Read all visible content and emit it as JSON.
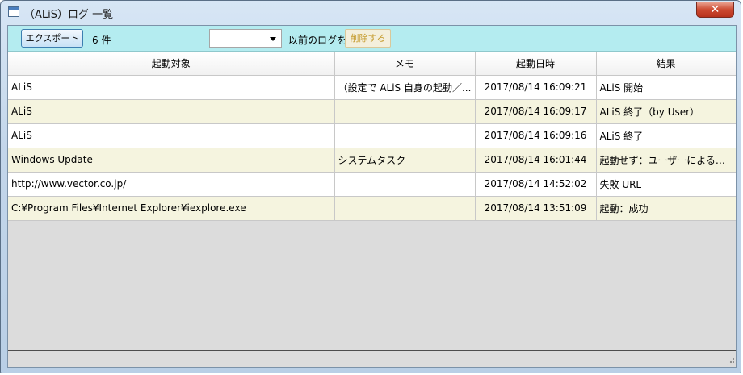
{
  "window": {
    "title": "（ALiS）ログ 一覧",
    "close_label": "✕"
  },
  "toolbar": {
    "export_label": "エクスポート",
    "count_text": "6 件",
    "date_select_value": "",
    "before_label": "以前のログを",
    "delete_label": "削除する"
  },
  "grid": {
    "columns": [
      "起動対象",
      "メモ",
      "起動日時",
      "結果"
    ],
    "rows": [
      {
        "target": "ALiS",
        "memo": "（設定で ALiS 自身の起動／...",
        "datetime": "2017/08/14 16:09:21",
        "result": "ALiS 開始"
      },
      {
        "target": "ALiS",
        "memo": "",
        "datetime": "2017/08/14 16:09:17",
        "result": "ALiS 終了（by User）"
      },
      {
        "target": "ALiS",
        "memo": "",
        "datetime": "2017/08/14 16:09:16",
        "result": "ALiS 終了"
      },
      {
        "target": "Windows Update",
        "memo": "システムタスク",
        "datetime": "2017/08/14 16:01:44",
        "result": "起動せず：ユーザーによるキャン..."
      },
      {
        "target": "http://www.vector.co.jp/",
        "memo": "",
        "datetime": "2017/08/14 14:52:02",
        "result": "失敗 URL"
      },
      {
        "target": "C:¥Program Files¥Internet Explorer¥iexplore.exe",
        "memo": "",
        "datetime": "2017/08/14 13:51:09",
        "result": "起動：成功"
      }
    ]
  },
  "colors": {
    "toolbar_bg": "#b4ecf0",
    "row_alt_bg": "#f5f4df",
    "close_button": "#cc4a31"
  }
}
